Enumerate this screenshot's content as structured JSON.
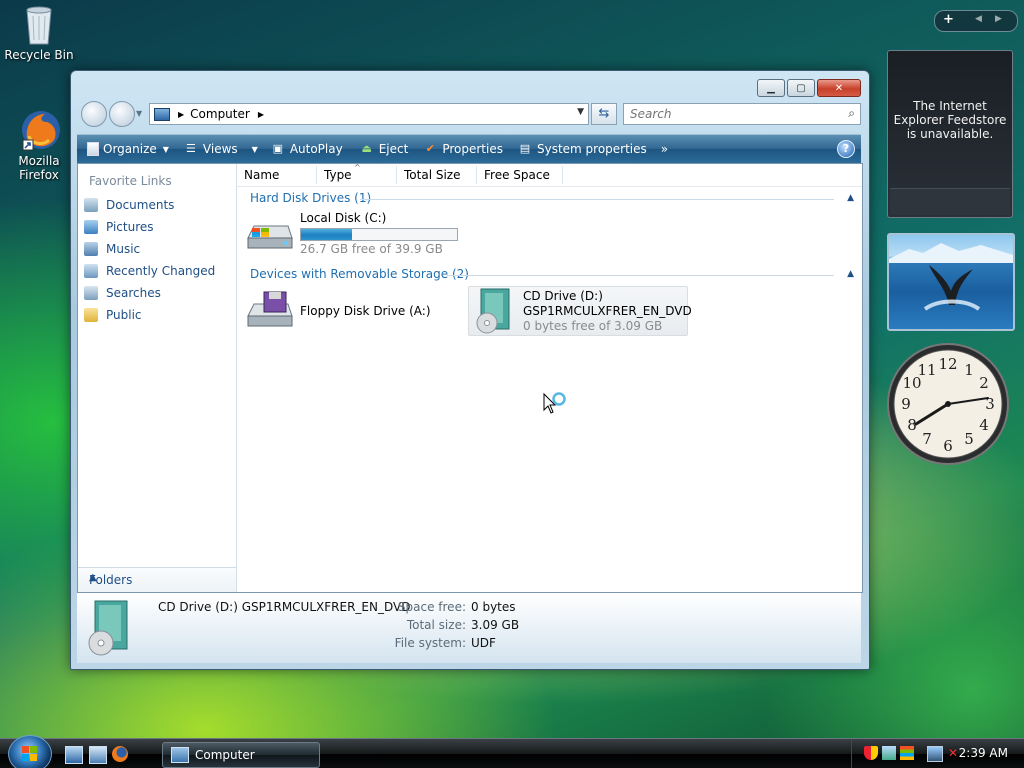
{
  "desktop": {
    "icons": [
      {
        "label": "Recycle Bin"
      },
      {
        "label": "Mozilla Firefox"
      }
    ]
  },
  "window": {
    "address": {
      "path": "Computer"
    },
    "search": {
      "placeholder": "Search"
    },
    "toolbar": {
      "organize": "Organize",
      "views": "Views",
      "autoplay": "AutoPlay",
      "eject": "Eject",
      "properties": "Properties",
      "system_properties": "System properties",
      "more": "»"
    },
    "favorite_links": {
      "title": "Favorite Links",
      "items": [
        "Documents",
        "Pictures",
        "Music",
        "Recently Changed",
        "Searches",
        "Public"
      ]
    },
    "folders_label": "Folders",
    "columns": [
      "Name",
      "Type",
      "Total Size",
      "Free Space"
    ],
    "groups": [
      {
        "title": "Hard Disk Drives (1)",
        "drives": [
          {
            "name": "Local Disk (C:)",
            "free_text": "26.7 GB free of 39.9 GB",
            "used_fraction": 0.33
          }
        ]
      },
      {
        "title": "Devices with Removable Storage (2)",
        "drives": [
          {
            "name": "Floppy Disk Drive (A:)"
          },
          {
            "name": "CD Drive (D:)",
            "label": "GSP1RMCULXFRER_EN_DVD",
            "free_text": "0 bytes free of 3.09 GB"
          }
        ]
      }
    ],
    "details": {
      "title": "CD Drive (D:) GSP1RMCULXFRER_EN_DVD",
      "space_free_label": "Space free:",
      "space_free": "0 bytes",
      "total_size_label": "Total size:",
      "total_size": "3.09 GB",
      "file_system_label": "File system:",
      "file_system": "UDF"
    }
  },
  "sidebar": {
    "feed_message": "The Internet Explorer Feedstore is unavailable.",
    "clock_numbers": [
      "12",
      "1",
      "2",
      "3",
      "4",
      "5",
      "6",
      "7",
      "8",
      "9",
      "10",
      "11"
    ]
  },
  "taskbar": {
    "task_label": "Computer",
    "time": "2:39 AM"
  }
}
